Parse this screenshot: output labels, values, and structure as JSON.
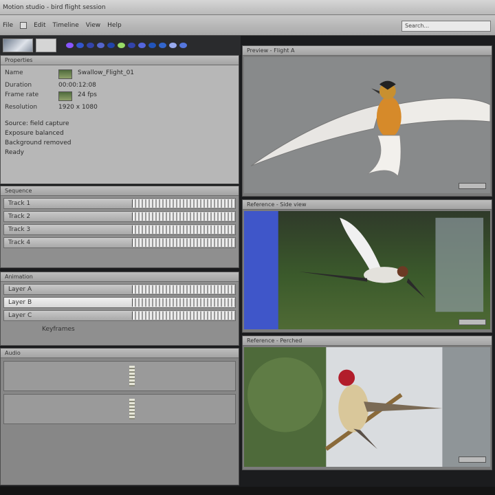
{
  "window": {
    "title": "Motion studio - bird flight session"
  },
  "menu": {
    "items": [
      "File",
      "Edit",
      "Timeline",
      "View",
      "Help"
    ],
    "search_placeholder": "Search..."
  },
  "palette": {
    "colors": [
      "#8855ff",
      "#3355cc",
      "#3344aa",
      "#5566cc",
      "#2244aa",
      "#99dd66",
      "#3344aa",
      "#5566dd",
      "#2255bb",
      "#3366cc",
      "#99aaee",
      "#5577dd"
    ]
  },
  "properties": {
    "title": "Properties",
    "rows": [
      {
        "k": "Name",
        "v": "Swallow_Flight_01"
      },
      {
        "k": "Duration",
        "v": "00:00:12:08"
      },
      {
        "k": "Frame rate",
        "v": "24 fps"
      },
      {
        "k": "Resolution",
        "v": "1920 x 1080"
      }
    ],
    "notes": [
      "Source: field capture",
      "Exposure balanced",
      "Background removed"
    ],
    "status_text": "Ready"
  },
  "timelines": [
    {
      "title": "Sequence",
      "tracks": [
        "Track 1",
        "Track 2",
        "Track 3",
        "Track 4"
      ]
    },
    {
      "title": "Animation",
      "tracks": [
        "Layer A",
        "Layer B",
        "Layer C"
      ],
      "selected": "Layer B",
      "footer": "Keyframes"
    },
    {
      "title": "Audio"
    }
  ],
  "viewers": [
    {
      "title": "Preview - Flight A"
    },
    {
      "title": "Reference - Side view"
    },
    {
      "title": "Reference - Perched"
    }
  ],
  "colors": {
    "sky_gray": "#8c8c8c",
    "blue_panel": "#3f56c9",
    "grass": "#3f5f2e",
    "bird_orange": "#d68a2a"
  }
}
